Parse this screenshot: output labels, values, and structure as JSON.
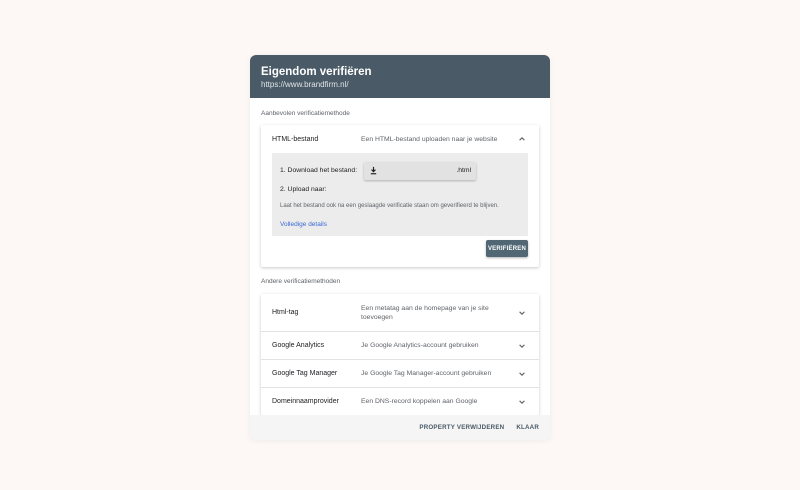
{
  "dialog": {
    "title": "Eigendom verifiëren",
    "subtitle": "https://www.brandfirm.nl/"
  },
  "recommended": {
    "label": "Aanbevolen verificatiemethode",
    "method": {
      "name": "HTML-bestand",
      "description": "Een HTML-bestand uploaden naar je website",
      "expanded": true,
      "steps": {
        "step1": "1. Download het bestand:",
        "download_file_ext": ".html",
        "step2": "2. Upload naar:",
        "hint": "Laat het bestand ook na een geslaagde verificatie staan om geverifieerd te blijven.",
        "details_link": "Volledige details"
      },
      "verify_label": "VERIFIËREN"
    }
  },
  "other": {
    "label": "Andere verificatiemethoden",
    "methods": [
      {
        "name": "Html-tag",
        "description": "Een metatag aan de homepage van je site toevoegen"
      },
      {
        "name": "Google Analytics",
        "description": "Je Google Analytics-account gebruiken"
      },
      {
        "name": "Google Tag Manager",
        "description": "Je Google Tag Manager-account gebruiken"
      },
      {
        "name": "Domeinnaamprovider",
        "description": "Een DNS-record koppelen aan Google"
      }
    ]
  },
  "footer": {
    "remove_label": "PROPERTY VERWIJDEREN",
    "done_label": "KLAAR"
  },
  "colors": {
    "header_bg": "#4a5a66",
    "verify_bg": "#526774",
    "link": "#3c6ad6",
    "page_bg": "#fdf8f6"
  },
  "icons": [
    "chevron-up-icon",
    "chevron-down-icon",
    "download-icon"
  ]
}
